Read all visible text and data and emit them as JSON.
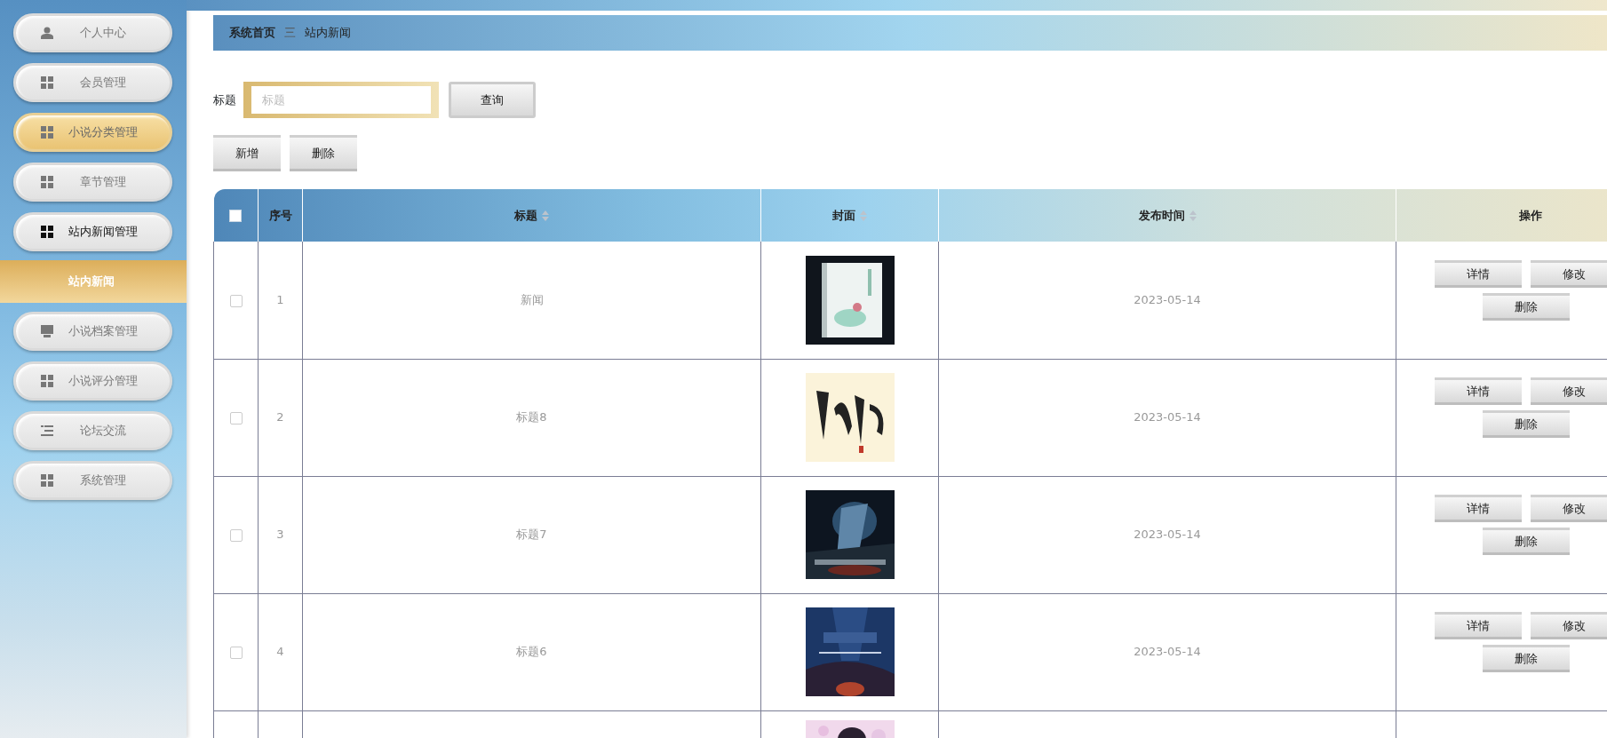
{
  "sidebar": {
    "items": [
      {
        "label": "个人中心",
        "kind": "user",
        "highlighted": false,
        "expanded": false
      },
      {
        "label": "会员管理",
        "kind": "grid",
        "highlighted": false,
        "expanded": false
      },
      {
        "label": "小说分类管理",
        "kind": "grid",
        "highlighted": true,
        "expanded": false
      },
      {
        "label": "章节管理",
        "kind": "grid",
        "highlighted": false,
        "expanded": false
      },
      {
        "label": "站内新闻管理",
        "kind": "grid",
        "highlighted": false,
        "expanded": true,
        "children": [
          {
            "label": "站内新闻"
          }
        ]
      },
      {
        "label": "小说档案管理",
        "kind": "monitor",
        "highlighted": false,
        "expanded": false
      },
      {
        "label": "小说评分管理",
        "kind": "grid",
        "highlighted": false,
        "expanded": false
      },
      {
        "label": "论坛交流",
        "kind": "list",
        "highlighted": false,
        "expanded": false
      },
      {
        "label": "系统管理",
        "kind": "grid",
        "highlighted": false,
        "expanded": false
      }
    ]
  },
  "breadcrumb": {
    "home": "系统首页",
    "separator": "三",
    "current": "站内新闻"
  },
  "search": {
    "label": "标题",
    "placeholder": "标题",
    "button": "查询"
  },
  "actions": [
    "新增",
    "删除"
  ],
  "table": {
    "select_all_checked": false,
    "columns": [
      {
        "label": "序号",
        "sortable": false
      },
      {
        "label": "标题",
        "sortable": true
      },
      {
        "label": "封面",
        "sortable": true
      },
      {
        "label": "发布时间",
        "sortable": true
      },
      {
        "label": "操作",
        "sortable": false
      }
    ],
    "rows": [
      {
        "index": "1",
        "title": "新闻",
        "date": "2023-05-14",
        "checked": false,
        "actions": [
          "详情",
          "修改",
          "删除"
        ]
      },
      {
        "index": "2",
        "title": "标题8",
        "date": "2023-05-14",
        "checked": false,
        "actions": [
          "详情",
          "修改",
          "删除"
        ]
      },
      {
        "index": "3",
        "title": "标题7",
        "date": "2023-05-14",
        "checked": false,
        "actions": [
          "详情",
          "修改",
          "删除"
        ]
      },
      {
        "index": "4",
        "title": "标题6",
        "date": "2023-05-14",
        "checked": false,
        "actions": [
          "详情",
          "修改",
          "删除"
        ]
      },
      {
        "actions": []
      }
    ]
  }
}
